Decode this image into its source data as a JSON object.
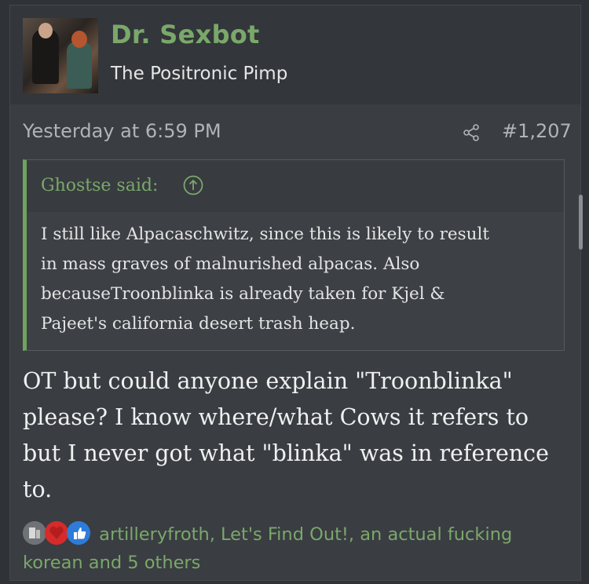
{
  "post": {
    "username": "Dr. Sexbot",
    "user_title": "The Positronic Pimp",
    "timestamp": "Yesterday at 6:59 PM",
    "post_number": "#1,207",
    "quote": {
      "attribution": "Ghostse said:",
      "lines": [
        "I still like Alpacaschwitz, since this is likely to result",
        "in mass graves of malnurished alpacas. Also",
        "becauseTroonblinka is already taken for Kjel &",
        "Pajeet's california desert trash heap."
      ]
    },
    "body_lines": [
      "OT but could anyone explain \"Troonblinka\"",
      "please? I know where/what Cows it refers to",
      "but I never got what \"blinka\" was in reference",
      "to."
    ],
    "reactions": {
      "icons": [
        "dumb-reaction-icon",
        "heart-reaction-icon",
        "like-reaction-icon"
      ],
      "text_line1": "artilleryfroth, Let's Find Out!, an actual fucking",
      "text_line2": "korean and 5 others"
    }
  },
  "colors": {
    "accent_green": "#7aa86a",
    "background": "#3a3d42",
    "header_bg": "#33363b"
  }
}
